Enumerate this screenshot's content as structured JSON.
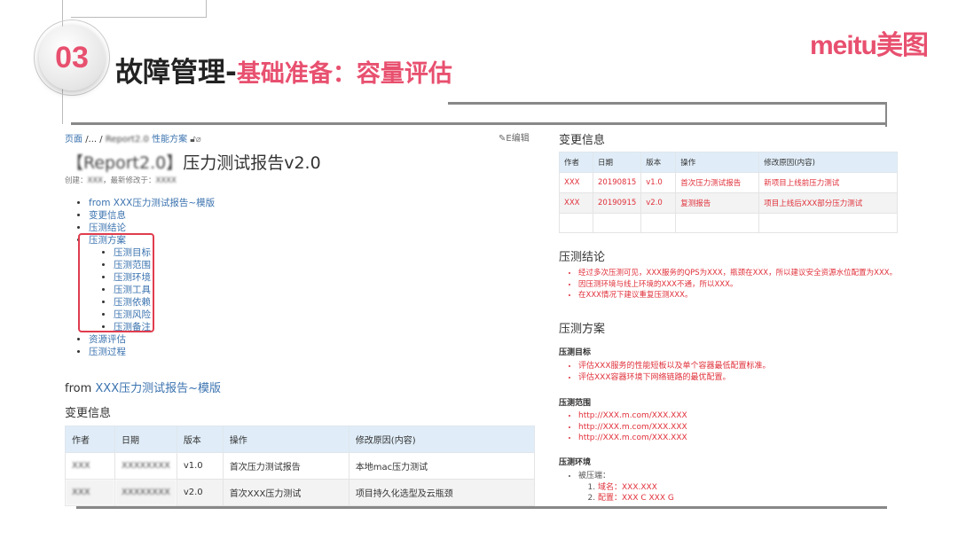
{
  "slide": {
    "number": "03",
    "title_main": "故障管理-",
    "title_accent": "基础准备：容量评估",
    "logo": "meitu美图"
  },
  "doc": {
    "breadcrumb": {
      "root": "页面",
      "sep": "/... /",
      "blurred": "Report2.0",
      "page": "性能方案"
    },
    "edit": "E编辑",
    "title_prefix": "【Report2.0】",
    "title": "压力测试报告v2.0",
    "meta_created": "创建：",
    "meta_created_by": "XXX",
    "meta_modified": "，最新修改于：",
    "meta_modified_val": "XXXX",
    "toc": [
      {
        "label": "from XXX压力测试报告~模版"
      },
      {
        "label": "变更信息"
      },
      {
        "label": "压测结论"
      },
      {
        "label": "压测方案",
        "children": [
          "压测目标",
          "压测范围",
          "压测环境",
          "压测工具",
          "压测依赖",
          "压测风险",
          "压测备注"
        ]
      },
      {
        "label": "资源评估"
      },
      {
        "label": "压测过程"
      }
    ],
    "from_prefix": "from ",
    "from_link": "XXX压力测试报告~模版",
    "change_heading": "变更信息",
    "table": {
      "headers": [
        "作者",
        "日期",
        "版本",
        "操作",
        "修改原因(内容)"
      ],
      "rows": [
        [
          "XXX",
          "XXXXXXXX",
          "v1.0",
          "首次压力测试报告",
          "本地mac压力测试"
        ],
        [
          "XXX",
          "XXXXXXXX",
          "v2.0",
          "首次XXX压力测试",
          "项目持久化选型及云瓶颈"
        ]
      ]
    }
  },
  "right": {
    "change_heading": "变更信息",
    "table": {
      "headers": [
        "作者",
        "日期",
        "版本",
        "操作",
        "修改原因(内容)"
      ],
      "rows": [
        [
          "XXX",
          "20190815",
          "v1.0",
          "首次压力测试报告",
          "新项目上线前压力测试"
        ],
        [
          "XXX",
          "20190915",
          "v2.0",
          "复测报告",
          "项目上线后XXX部分压力测试"
        ],
        [
          "",
          "",
          "",
          "",
          ""
        ]
      ]
    },
    "conclusion_heading": "压测结论",
    "conclusions": [
      "经过多次压测可见，XXX服务的QPS为XXX，瓶颈在XXX，所以建议安全资源水位配置为XXX。",
      "因压测环境与线上环境的XXX不通，所以XXX。",
      "在XXX情况下建议重复压测XXX。"
    ],
    "plan_heading": "压测方案",
    "goal_heading": "压测目标",
    "goals": [
      "评估XXX服务的性能短板以及单个容器最低配置标准。",
      "评估XXX容器环境下网络链路的最优配置。"
    ],
    "scope_heading": "压测范围",
    "scope": [
      "http://XXX.m.com/XXX.XXX",
      "http://XXX.m.com/XXX.XXX",
      "http://XXX.m.com/XXX.XXX"
    ],
    "env_heading": "压测环境",
    "env_item": "被压端：",
    "env_sub": [
      {
        "k": "域名",
        "v": "：XXX.XXX"
      },
      {
        "k": "配置",
        "v": "：XXX C XXX G"
      }
    ]
  },
  "colors": {
    "accent": "#e8506f",
    "link": "#3b73af",
    "red": "#e0303a"
  }
}
